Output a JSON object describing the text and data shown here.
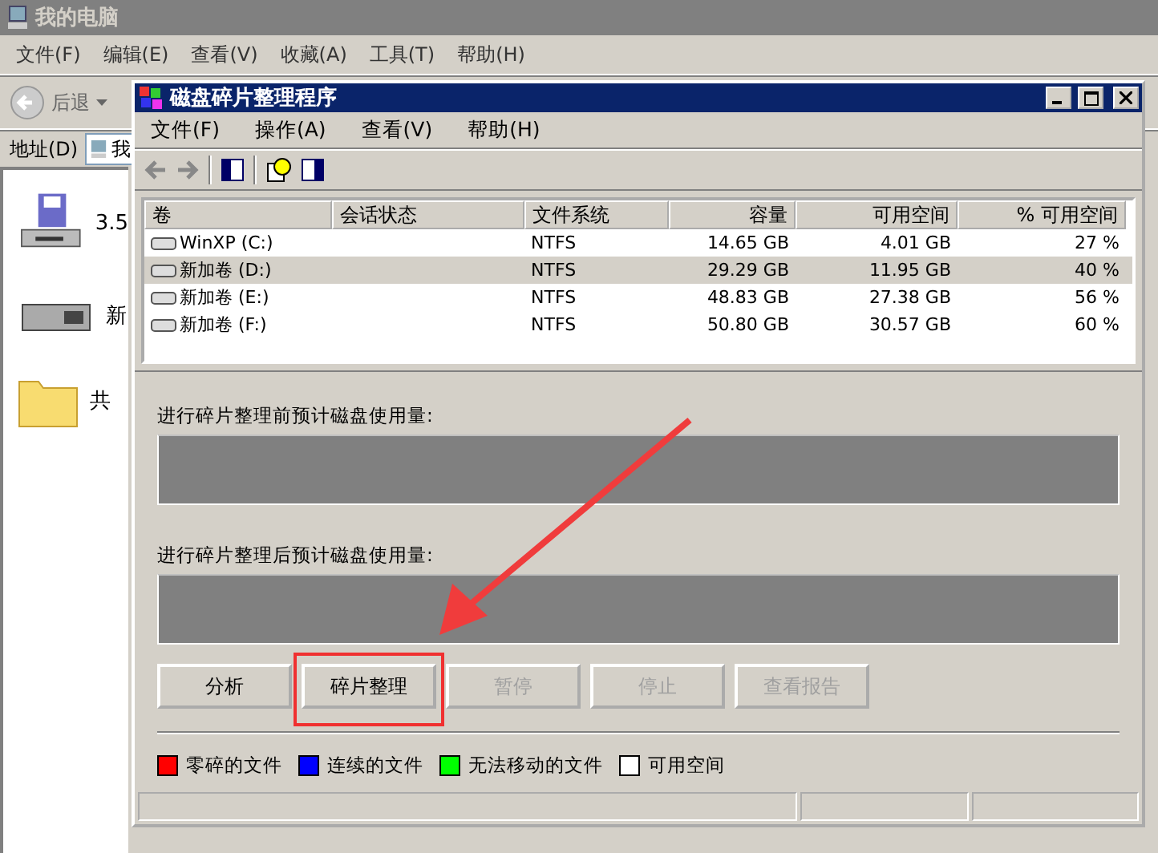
{
  "explorer": {
    "title": "我的电脑",
    "menu": [
      "文件(F)",
      "编辑(E)",
      "查看(V)",
      "收藏(A)",
      "工具(T)",
      "帮助(H)"
    ],
    "back_label": "后退",
    "address_label": "地址(D)",
    "address_value": "我",
    "items": [
      {
        "label": "3.5",
        "kind": "floppy"
      },
      {
        "label": "新",
        "kind": "drive"
      },
      {
        "label": "共",
        "kind": "folder"
      }
    ]
  },
  "defrag": {
    "title": "磁盘碎片整理程序",
    "menu": [
      "文件(F)",
      "操作(A)",
      "查看(V)",
      "帮助(H)"
    ],
    "columns": [
      "卷",
      "会话状态",
      "文件系统",
      "容量",
      "可用空间",
      "% 可用空间"
    ],
    "rows": [
      {
        "volume": "WinXP (C:)",
        "file_system": "NTFS",
        "capacity": "14.65 GB",
        "free_space": "4.01 GB",
        "percent_free": "27 %",
        "selected": false
      },
      {
        "volume": "新加卷 (D:)",
        "file_system": "NTFS",
        "capacity": "29.29 GB",
        "free_space": "11.95 GB",
        "percent_free": "40 %",
        "selected": true
      },
      {
        "volume": "新加卷 (E:)",
        "file_system": "NTFS",
        "capacity": "48.83 GB",
        "free_space": "27.38 GB",
        "percent_free": "56 %",
        "selected": false
      },
      {
        "volume": "新加卷 (F:)",
        "file_system": "NTFS",
        "capacity": "50.80 GB",
        "free_space": "30.57 GB",
        "percent_free": "60 %",
        "selected": false
      }
    ],
    "before_label": "进行碎片整理前预计磁盘使用量:",
    "after_label": "进行碎片整理后预计磁盘使用量:",
    "buttons": [
      {
        "label": "分析",
        "disabled": false,
        "highlighted": false
      },
      {
        "label": "碎片整理",
        "disabled": false,
        "highlighted": true
      },
      {
        "label": "暂停",
        "disabled": true,
        "highlighted": false
      },
      {
        "label": "停止",
        "disabled": true,
        "highlighted": false
      },
      {
        "label": "查看报告",
        "disabled": true,
        "highlighted": false
      }
    ],
    "legend": [
      {
        "label": "零碎的文件",
        "color": "#ff0000"
      },
      {
        "label": "连续的文件",
        "color": "#0000ff"
      },
      {
        "label": "无法移动的文件",
        "color": "#00ff00"
      },
      {
        "label": "可用空间",
        "color": "#ffffff"
      }
    ]
  }
}
